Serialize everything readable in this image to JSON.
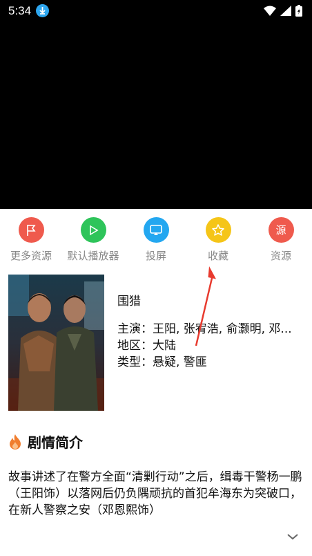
{
  "status_bar": {
    "time": "5:34"
  },
  "actions": [
    {
      "label": "更多资源",
      "color": "#ef5a4d",
      "icon": "flag-icon"
    },
    {
      "label": "默认播放器",
      "color": "#2ec45a",
      "icon": "play-icon"
    },
    {
      "label": "投屏",
      "color": "#23a7f0",
      "icon": "cast-icon"
    },
    {
      "label": "收藏",
      "color": "#f5c518",
      "icon": "star-icon"
    },
    {
      "label": "资源",
      "color": "#ef5a4d",
      "icon": "source-icon",
      "glyph": "源"
    }
  ],
  "movie": {
    "title": "围猎",
    "cast": "主演：王阳, 张宥浩, 俞灏明, 邓...",
    "region": "地区：大陆",
    "genre": "类型：悬疑, 警匪"
  },
  "synopsis": {
    "heading": "剧情简介",
    "text": "故事讲述了在警方全面“清剿行动”之后，缉毒干警杨一鹏（王阳饰）以落网后仍负隅顽抗的首犯牟海东为突破口，在新人警察之安（邓恩熙饰）"
  },
  "colors": {
    "flame": "#f07d2e",
    "annotation_arrow": "#e83a2e"
  }
}
